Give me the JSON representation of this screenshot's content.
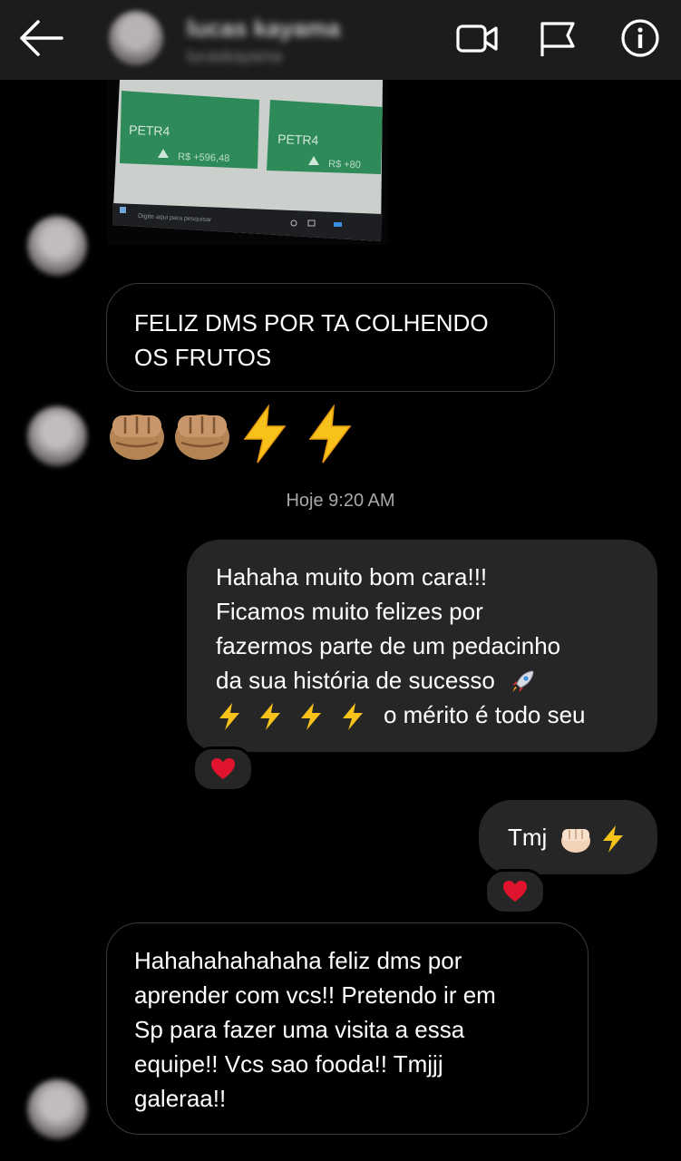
{
  "header": {
    "name": "lucas kayama",
    "username": "lucaskayama"
  },
  "photo": {
    "card1_ticker": "PETR4",
    "card1_value": "R$ +596,48",
    "card2_ticker": "PETR4",
    "card2_value": "R$ +80",
    "taskbar_search": "Digite aqui para pesquisar"
  },
  "messages": [
    {
      "from": "them",
      "text": "FELIZ DMS POR TA COLHENDO OS FRUTOS",
      "line1": "FELIZ DMS POR TA COLHENDO",
      "line2": "OS FRUTOS"
    },
    {
      "from": "them",
      "emojis": [
        "fist",
        "fist",
        "lightning",
        "lightning"
      ]
    },
    {
      "from": "me",
      "line1": "Hahaha muito bom cara!!!",
      "line2": "Ficamos muito felizes por",
      "line3": "fazermos parte de um pedacinho",
      "line4": "da sua história de sucesso",
      "line5": "o mérito é todo seu",
      "reaction": "heart"
    },
    {
      "from": "me",
      "text": "Tmj",
      "reaction": "heart"
    },
    {
      "from": "them",
      "line1": "Hahahahahahaha feliz dms por",
      "line2": "aprender com vcs!! Pretendo ir em",
      "line3": "Sp para fazer uma visita a essa",
      "line4": "equipe!! Vcs sao fooda!! Tmjjj",
      "line5": "galeraa!!"
    }
  ],
  "timestamp": "Hoje 9:20 AM",
  "icons": [
    "back-arrow-icon",
    "video-call-icon",
    "flag-icon",
    "info-icon",
    "heart-icon",
    "fist-emoji",
    "lightning-emoji",
    "rocket-emoji"
  ],
  "colors": {
    "background": "#000000",
    "header": "#1c1c1c",
    "sent_bubble": "#262626",
    "received_border": "#3a3a3a",
    "heart": "#e0142d",
    "timestamp": "#a8a8a8"
  }
}
